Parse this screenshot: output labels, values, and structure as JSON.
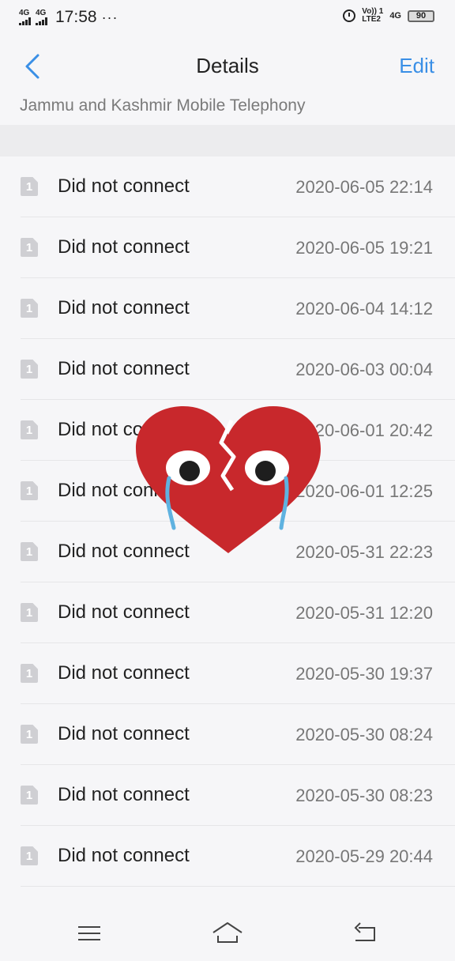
{
  "status_bar": {
    "network_1": "4G",
    "network_2": "4G",
    "time": "17:58",
    "more": "···",
    "volte": "Vo)) 1",
    "lte": "LTE2",
    "network_3": "4G",
    "battery": "90"
  },
  "header": {
    "title": "Details",
    "edit_label": "Edit",
    "back_icon": "chevron-left-icon"
  },
  "contact": {
    "carrier": "Jammu and Kashmir Mobile Telephony"
  },
  "calls": [
    {
      "sim": "1",
      "status": "Did not connect",
      "datetime": "2020-06-05 22:14"
    },
    {
      "sim": "1",
      "status": "Did not connect",
      "datetime": "2020-06-05 19:21"
    },
    {
      "sim": "1",
      "status": "Did not connect",
      "datetime": "2020-06-04 14:12"
    },
    {
      "sim": "1",
      "status": "Did not connect",
      "datetime": "2020-06-03 00:04"
    },
    {
      "sim": "1",
      "status": "Did not connect",
      "datetime": "2020-06-01 20:42"
    },
    {
      "sim": "1",
      "status": "Did not connect",
      "datetime": "2020-06-01 12:25"
    },
    {
      "sim": "1",
      "status": "Did not connect",
      "datetime": "2020-05-31 22:23"
    },
    {
      "sim": "1",
      "status": "Did not connect",
      "datetime": "2020-05-31 12:20"
    },
    {
      "sim": "1",
      "status": "Did not connect",
      "datetime": "2020-05-30 19:37"
    },
    {
      "sim": "1",
      "status": "Did not connect",
      "datetime": "2020-05-30 08:24"
    },
    {
      "sim": "1",
      "status": "Did not connect",
      "datetime": "2020-05-30 08:23"
    },
    {
      "sim": "1",
      "status": "Did not connect",
      "datetime": "2020-05-29 20:44"
    }
  ],
  "overlay": {
    "icon": "crying-broken-heart-sticker"
  },
  "nav": {
    "menu_icon": "menu-icon",
    "home_icon": "home-icon",
    "back_icon": "back-icon"
  },
  "colors": {
    "accent": "#3a8fe6",
    "heart": "#c8282c",
    "tear": "#5fb2e0"
  }
}
